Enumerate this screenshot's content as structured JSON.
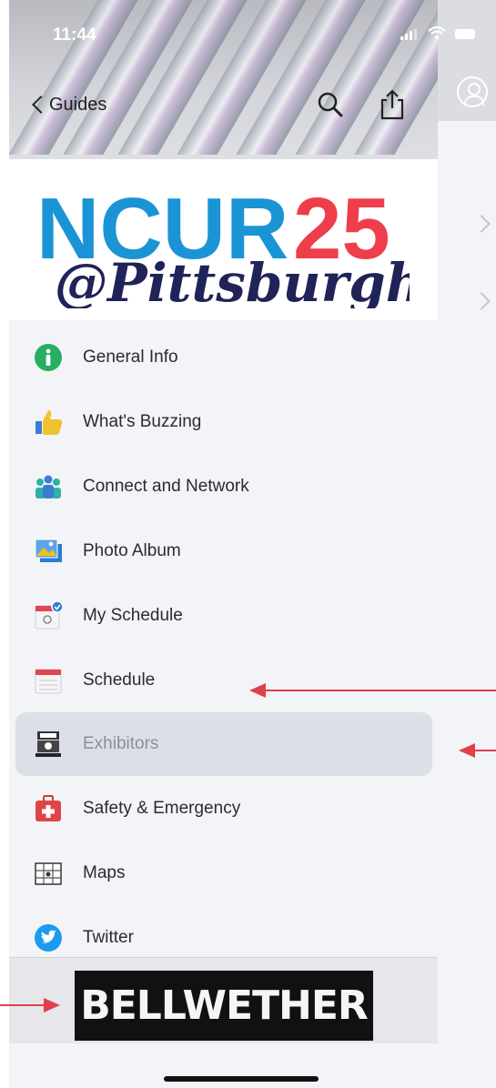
{
  "status_bar": {
    "time": "11:44"
  },
  "nav": {
    "back_label": "Guides"
  },
  "logo": {
    "line1_a": "NCUR",
    "line1_b": "25",
    "line2": "@Pittsburgh"
  },
  "menu": {
    "items": [
      {
        "label": "General Info",
        "icon": "info-icon",
        "selected": false
      },
      {
        "label": "What's Buzzing",
        "icon": "thumbs-up-icon",
        "selected": false
      },
      {
        "label": "Connect and Network",
        "icon": "people-icon",
        "selected": false
      },
      {
        "label": "Photo Album",
        "icon": "photo-album-icon",
        "selected": false
      },
      {
        "label": "My Schedule",
        "icon": "my-schedule-icon",
        "selected": false
      },
      {
        "label": "Schedule",
        "icon": "calendar-icon",
        "selected": false
      },
      {
        "label": "Exhibitors",
        "icon": "exhibitor-booth-icon",
        "selected": true
      },
      {
        "label": "Safety & Emergency",
        "icon": "first-aid-icon",
        "selected": false
      },
      {
        "label": "Maps",
        "icon": "map-icon",
        "selected": false
      },
      {
        "label": "Twitter",
        "icon": "twitter-icon",
        "selected": false
      }
    ]
  },
  "sponsor": {
    "label": "BELLWETHER"
  },
  "colors": {
    "logo_blue": "#1b94d6",
    "logo_red": "#ee3d4b",
    "logo_navy": "#1f2357",
    "selected_bg": "#dcdee8",
    "annotation_red": "#e0404a"
  }
}
